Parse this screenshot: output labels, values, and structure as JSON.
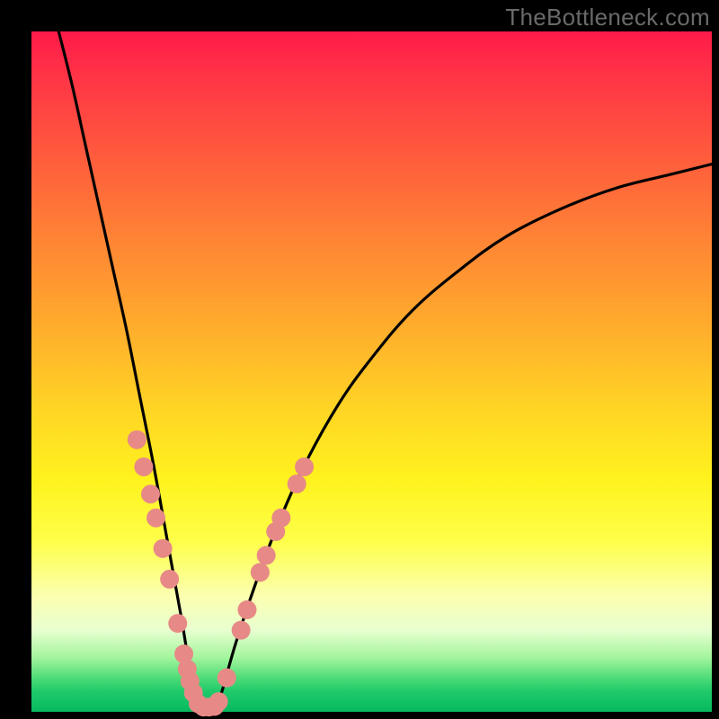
{
  "watermark": "TheBottleneck.com",
  "chart_data": {
    "type": "line",
    "title": "",
    "xlabel": "",
    "ylabel": "",
    "xlim": [
      0,
      100
    ],
    "ylim": [
      0,
      100
    ],
    "grid": false,
    "legend": false,
    "series": [
      {
        "name": "bottleneck-curve",
        "color": "#000000",
        "values_note": "Pairs are [x_percent, y_percent_from_bottom]. V-shaped curve with minimum near x≈25.",
        "xy": [
          [
            4,
            100
          ],
          [
            6,
            92
          ],
          [
            8,
            83
          ],
          [
            10,
            74
          ],
          [
            12,
            65
          ],
          [
            14,
            56
          ],
          [
            16,
            46
          ],
          [
            18,
            36
          ],
          [
            20,
            25
          ],
          [
            22,
            14
          ],
          [
            23,
            8
          ],
          [
            24,
            3
          ],
          [
            25,
            0.3
          ],
          [
            26,
            0.3
          ],
          [
            27,
            0.5
          ],
          [
            28,
            3
          ],
          [
            30,
            10
          ],
          [
            33,
            19
          ],
          [
            36,
            27
          ],
          [
            40,
            36
          ],
          [
            45,
            45
          ],
          [
            50,
            52
          ],
          [
            56,
            59
          ],
          [
            63,
            65
          ],
          [
            70,
            70
          ],
          [
            78,
            74
          ],
          [
            86,
            77
          ],
          [
            94,
            79
          ],
          [
            100,
            80.5
          ]
        ]
      },
      {
        "name": "highlighted-points-left",
        "color": "#e78a87",
        "xy": [
          [
            15.5,
            40
          ],
          [
            16.5,
            36
          ],
          [
            17.5,
            32
          ],
          [
            18.3,
            28.5
          ],
          [
            19.3,
            24
          ],
          [
            20.3,
            19.5
          ],
          [
            21.5,
            13
          ],
          [
            22.4,
            8.5
          ],
          [
            22.9,
            6.3
          ],
          [
            23.3,
            4.5
          ],
          [
            23.8,
            2.8
          ],
          [
            24.5,
            1.2
          ],
          [
            25.3,
            0.7
          ],
          [
            26.1,
            0.7
          ]
        ]
      },
      {
        "name": "highlighted-points-right",
        "color": "#e78a87",
        "xy": [
          [
            26.9,
            0.8
          ],
          [
            27.5,
            1.5
          ],
          [
            28.7,
            5
          ],
          [
            30.8,
            12
          ],
          [
            31.7,
            15
          ],
          [
            33.6,
            20.5
          ],
          [
            34.5,
            23
          ],
          [
            35.9,
            26.5
          ],
          [
            36.7,
            28.5
          ],
          [
            39.0,
            33.5
          ],
          [
            40.1,
            36.0
          ]
        ]
      }
    ]
  },
  "colors": {
    "dot": "#e78a87",
    "curve": "#000000",
    "frame": "#000000"
  }
}
